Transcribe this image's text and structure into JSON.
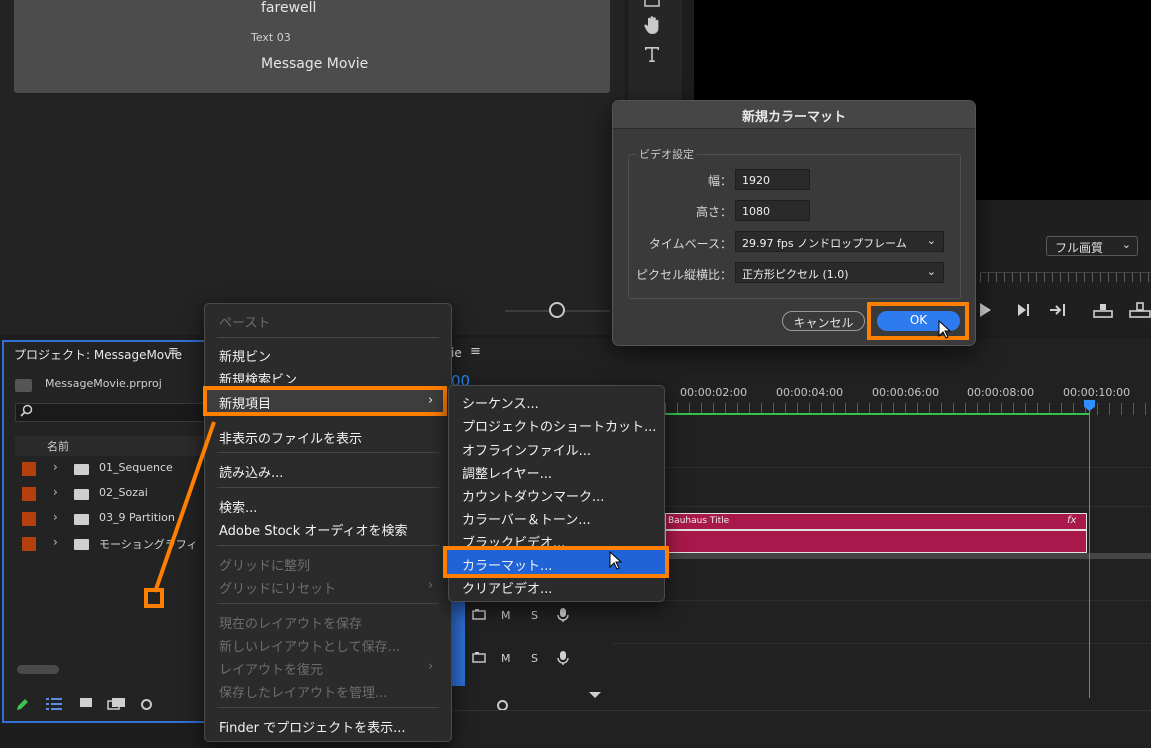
{
  "essential_graphics": {
    "text_farewell": "farewell",
    "text_label": "Text 03",
    "text_message": "Message Movie"
  },
  "tools": {
    "hand": "hand-icon",
    "type": "type-icon"
  },
  "program_monitor": {
    "quality": "フル画質"
  },
  "project": {
    "title": "プロジェクト: MessageMovie",
    "file": "MessageMovie.prproj",
    "column_name": "名前",
    "bins": [
      "01_Sequence",
      "02_Sozai",
      "03_9 Partition",
      "モーショングラフィ"
    ],
    "swatch_color": "#b5400f"
  },
  "timeline": {
    "tab_fragment": "ie",
    "timecode_fragment": "00",
    "times": [
      "00:00:02:00",
      "00:00:04:00",
      "00:00:06:00",
      "00:00:08:00",
      "00:00:10:00"
    ],
    "clip_name": "Bauhaus Title",
    "fx": "fx",
    "track_m": "M",
    "track_s": "S",
    "clip_color": "#a8184a",
    "playhead_color": "#2f8fff"
  },
  "context_menu": {
    "paste": "ペースト",
    "new_bin": "新規ビン",
    "new_search_bin": "新規検索ビン",
    "new_item": "新規項目",
    "show_hidden": "非表示のファイルを表示",
    "import": "読み込み...",
    "find": "検索...",
    "adobe_stock": "Adobe Stock オーディオを検索",
    "align_grid": "グリッドに整列",
    "reset_grid": "グリッドにリセット",
    "save_layout": "現在のレイアウトを保存",
    "save_new_layout": "新しいレイアウトとして保存...",
    "restore_layout": "レイアウトを復元",
    "manage_layouts": "保存したレイアウトを管理...",
    "reveal_finder": "Finder でプロジェクトを表示..."
  },
  "submenu": {
    "items": [
      "シーケンス...",
      "プロジェクトのショートカット...",
      "オフラインファイル...",
      "調整レイヤー...",
      "カウントダウンマーク...",
      "カラーバー＆トーン...",
      "ブラックビデオ...",
      "カラーマット...",
      "クリアビデオ..."
    ]
  },
  "dialog": {
    "title": "新規カラーマット",
    "group": "ビデオ設定",
    "width_label": "幅：",
    "width_value": "1920",
    "height_label": "高さ：",
    "height_value": "1080",
    "timebase_label": "タイムベース：",
    "timebase_value": "29.97 fps ノンドロップフレーム",
    "pixel_aspect_label": "ピクセル縦横比：",
    "pixel_aspect_value": "正方形ピクセル (1.0)",
    "cancel": "キャンセル",
    "ok": "OK"
  },
  "annotation": {
    "highlight_color": "#ff7f00"
  }
}
